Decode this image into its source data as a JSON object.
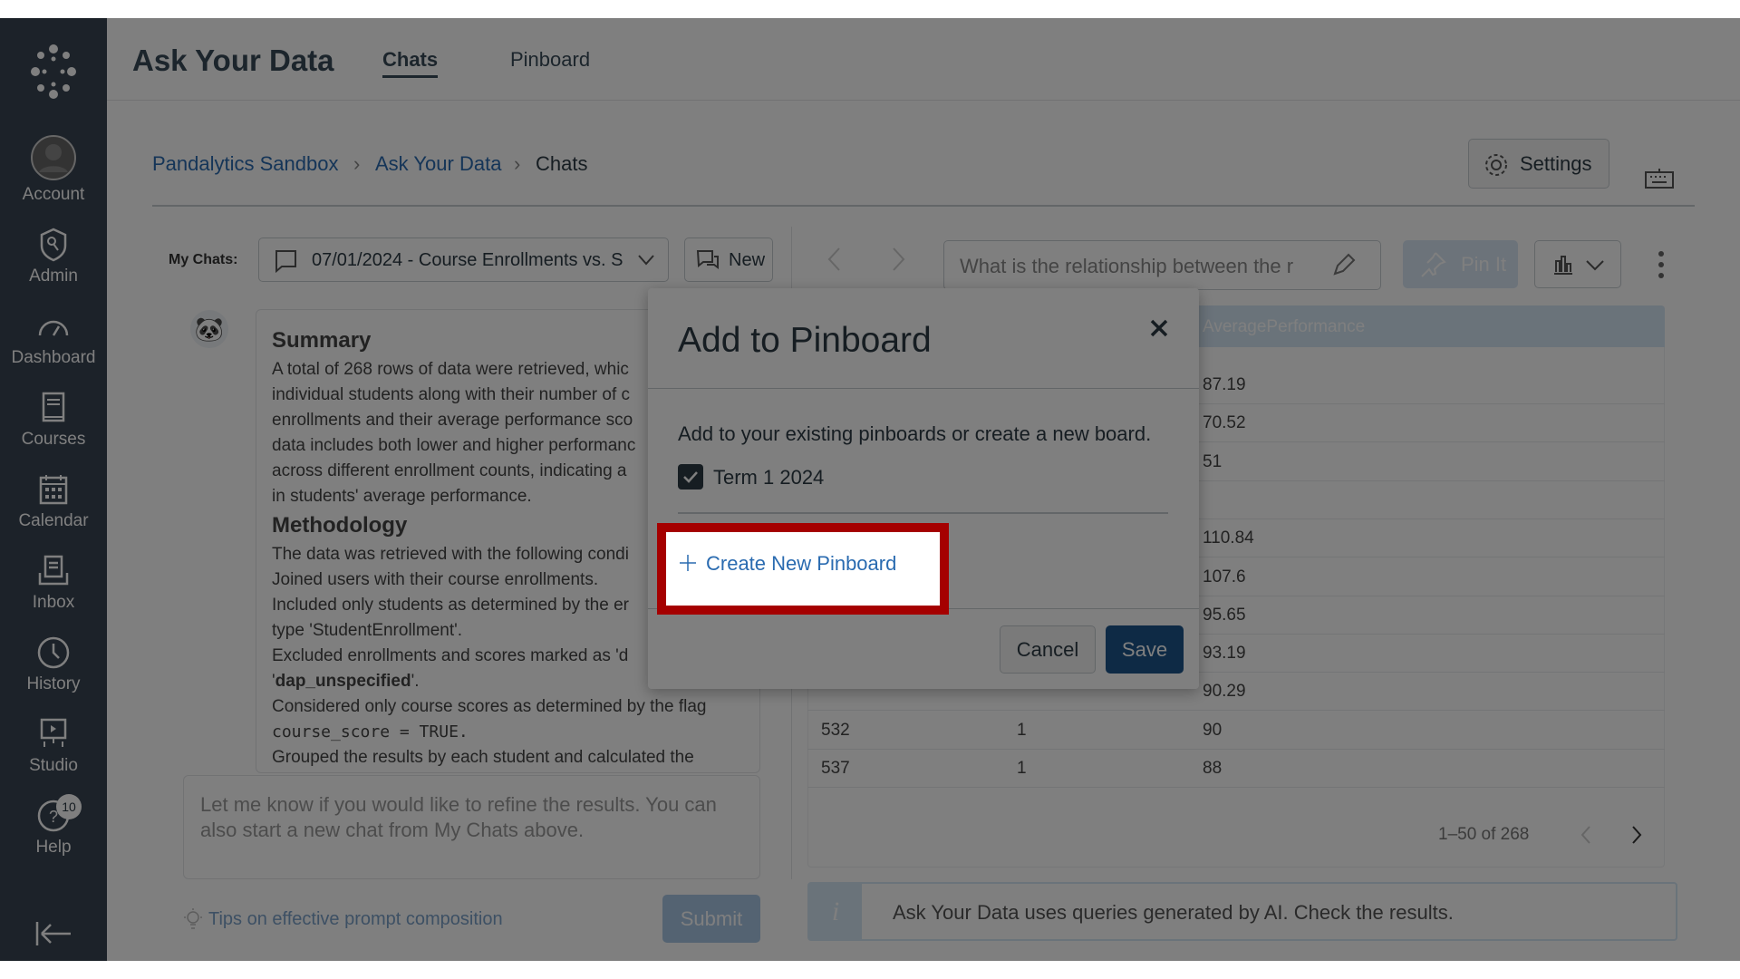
{
  "sidebar": {
    "items": [
      {
        "label": "Account",
        "icon": "account-icon"
      },
      {
        "label": "Admin",
        "icon": "admin-shield-icon"
      },
      {
        "label": "Dashboard",
        "icon": "dashboard-icon"
      },
      {
        "label": "Courses",
        "icon": "courses-icon"
      },
      {
        "label": "Calendar",
        "icon": "calendar-icon"
      },
      {
        "label": "Inbox",
        "icon": "inbox-icon"
      },
      {
        "label": "History",
        "icon": "history-clock-icon"
      },
      {
        "label": "Studio",
        "icon": "studio-icon"
      },
      {
        "label": "Help",
        "icon": "help-icon",
        "badge": "10"
      }
    ]
  },
  "header": {
    "title": "Ask Your Data",
    "tabs": [
      {
        "label": "Chats",
        "active": true
      },
      {
        "label": "Pinboard",
        "active": false
      }
    ]
  },
  "breadcrumb": [
    "Pandalytics Sandbox",
    "Ask Your Data",
    "Chats"
  ],
  "toolbar": {
    "settings_label": "Settings"
  },
  "chats": {
    "my_chats_label": "My Chats:",
    "selected_chat": "07/01/2024 - Course Enrollments vs. S",
    "new_label": "New",
    "summary_heading": "Summary",
    "summary_lines": [
      "A total of 268 rows of data were retrieved, whic",
      "individual students along with their number of c",
      "enrollments and their average performance sco",
      "data includes both lower and higher performanc",
      "across different enrollment counts, indicating a",
      "in students' average performance."
    ],
    "methodology_heading": "Methodology",
    "methodology_lines": [
      "The data was retrieved with the following condi",
      "Joined users with their course enrollments.",
      "Included only students as determined by the er",
      "type 'StudentEnrollment'.",
      "Excluded enrollments and scores marked as 'd"
    ],
    "dap_value": "dap_unspecified",
    "considered_line": "Considered only course scores as determined by the flag",
    "code_line": "course_score = TRUE.",
    "grouped_line": "Grouped the results by each student and calculated the",
    "input_placeholder": "Let me know if you would like to refine the results.  You can also start a new chat from My Chats above.",
    "tips_label": "Tips on effective prompt composition",
    "submit_label": "Submit"
  },
  "results": {
    "question_placeholder": "What is the relationship between the r",
    "pin_label": "Pin It",
    "column_header": "AveragePerformance",
    "rows": [
      {
        "id": "",
        "count": "",
        "avg": "87.19"
      },
      {
        "id": "",
        "count": "",
        "avg": "70.52"
      },
      {
        "id": "",
        "count": "",
        "avg": "51"
      },
      {
        "id": "",
        "count": "",
        "avg": ""
      },
      {
        "id": "",
        "count": "",
        "avg": "110.84"
      },
      {
        "id": "",
        "count": "",
        "avg": "107.6"
      },
      {
        "id": "",
        "count": "",
        "avg": "95.65"
      },
      {
        "id": "",
        "count": "",
        "avg": "93.19"
      },
      {
        "id": "",
        "count": "",
        "avg": "90.29"
      },
      {
        "id": "532",
        "count": "1",
        "avg": "90"
      },
      {
        "id": "537",
        "count": "1",
        "avg": "88"
      }
    ],
    "pagination": "1–50 of 268",
    "info_banner": "Ask Your Data uses queries generated by AI. Check the results."
  },
  "dialog": {
    "title": "Add to Pinboard",
    "description": "Add to your existing pinboards or create a new board.",
    "pinboards": [
      {
        "label": "Term 1 2024",
        "checked": true
      }
    ],
    "create_label": "Create New Pinboard",
    "cancel_label": "Cancel",
    "save_label": "Save"
  },
  "colors": {
    "sidebar": "#394552",
    "highlight": "#a50000",
    "save": "#1c548a",
    "link": "#2a6bb0"
  }
}
